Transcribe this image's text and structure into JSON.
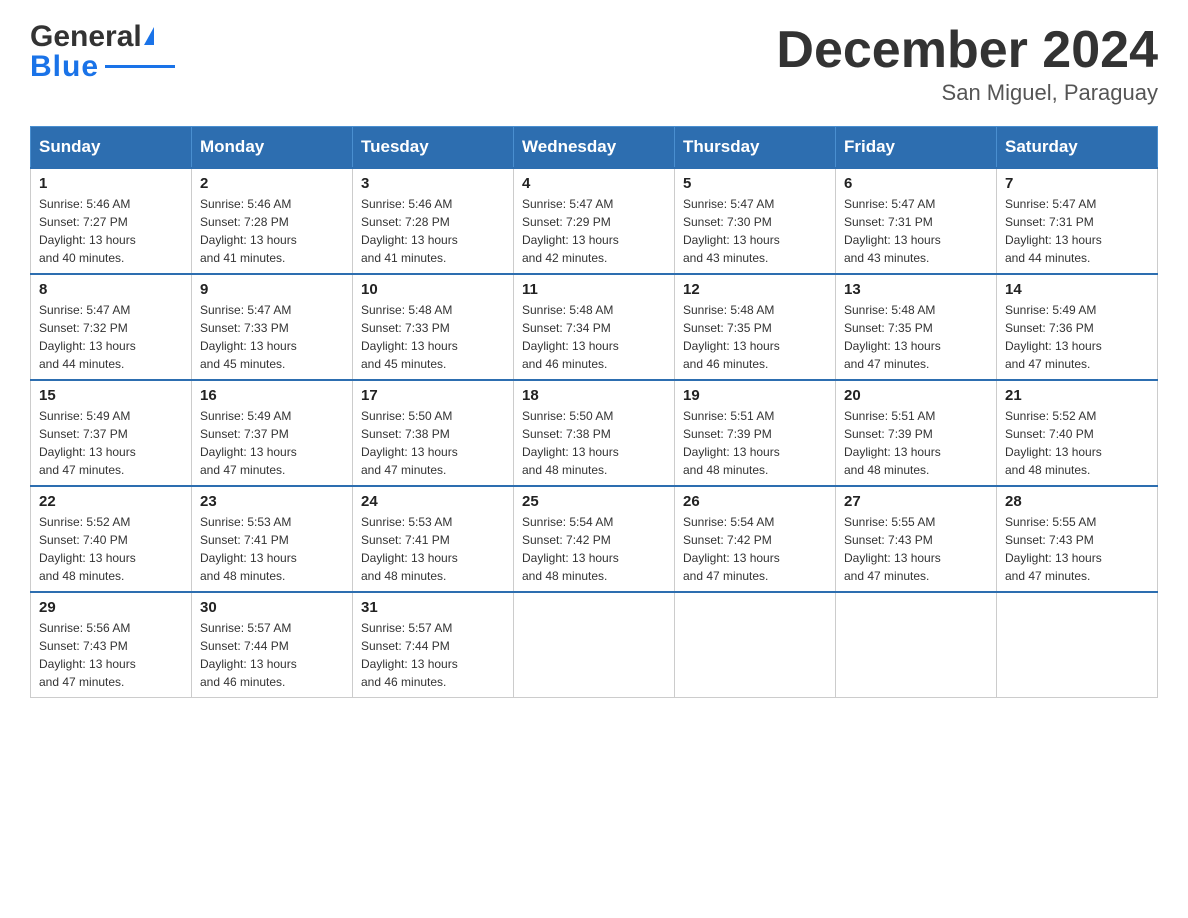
{
  "logo": {
    "text_general": "General",
    "text_blue": "Blue",
    "triangle": "▶"
  },
  "header": {
    "title": "December 2024",
    "subtitle": "San Miguel, Paraguay"
  },
  "weekdays": [
    "Sunday",
    "Monday",
    "Tuesday",
    "Wednesday",
    "Thursday",
    "Friday",
    "Saturday"
  ],
  "weeks": [
    [
      {
        "day": "1",
        "sunrise": "5:46 AM",
        "sunset": "7:27 PM",
        "daylight": "13 hours and 40 minutes."
      },
      {
        "day": "2",
        "sunrise": "5:46 AM",
        "sunset": "7:28 PM",
        "daylight": "13 hours and 41 minutes."
      },
      {
        "day": "3",
        "sunrise": "5:46 AM",
        "sunset": "7:28 PM",
        "daylight": "13 hours and 41 minutes."
      },
      {
        "day": "4",
        "sunrise": "5:47 AM",
        "sunset": "7:29 PM",
        "daylight": "13 hours and 42 minutes."
      },
      {
        "day": "5",
        "sunrise": "5:47 AM",
        "sunset": "7:30 PM",
        "daylight": "13 hours and 43 minutes."
      },
      {
        "day": "6",
        "sunrise": "5:47 AM",
        "sunset": "7:31 PM",
        "daylight": "13 hours and 43 minutes."
      },
      {
        "day": "7",
        "sunrise": "5:47 AM",
        "sunset": "7:31 PM",
        "daylight": "13 hours and 44 minutes."
      }
    ],
    [
      {
        "day": "8",
        "sunrise": "5:47 AM",
        "sunset": "7:32 PM",
        "daylight": "13 hours and 44 minutes."
      },
      {
        "day": "9",
        "sunrise": "5:47 AM",
        "sunset": "7:33 PM",
        "daylight": "13 hours and 45 minutes."
      },
      {
        "day": "10",
        "sunrise": "5:48 AM",
        "sunset": "7:33 PM",
        "daylight": "13 hours and 45 minutes."
      },
      {
        "day": "11",
        "sunrise": "5:48 AM",
        "sunset": "7:34 PM",
        "daylight": "13 hours and 46 minutes."
      },
      {
        "day": "12",
        "sunrise": "5:48 AM",
        "sunset": "7:35 PM",
        "daylight": "13 hours and 46 minutes."
      },
      {
        "day": "13",
        "sunrise": "5:48 AM",
        "sunset": "7:35 PM",
        "daylight": "13 hours and 47 minutes."
      },
      {
        "day": "14",
        "sunrise": "5:49 AM",
        "sunset": "7:36 PM",
        "daylight": "13 hours and 47 minutes."
      }
    ],
    [
      {
        "day": "15",
        "sunrise": "5:49 AM",
        "sunset": "7:37 PM",
        "daylight": "13 hours and 47 minutes."
      },
      {
        "day": "16",
        "sunrise": "5:49 AM",
        "sunset": "7:37 PM",
        "daylight": "13 hours and 47 minutes."
      },
      {
        "day": "17",
        "sunrise": "5:50 AM",
        "sunset": "7:38 PM",
        "daylight": "13 hours and 47 minutes."
      },
      {
        "day": "18",
        "sunrise": "5:50 AM",
        "sunset": "7:38 PM",
        "daylight": "13 hours and 48 minutes."
      },
      {
        "day": "19",
        "sunrise": "5:51 AM",
        "sunset": "7:39 PM",
        "daylight": "13 hours and 48 minutes."
      },
      {
        "day": "20",
        "sunrise": "5:51 AM",
        "sunset": "7:39 PM",
        "daylight": "13 hours and 48 minutes."
      },
      {
        "day": "21",
        "sunrise": "5:52 AM",
        "sunset": "7:40 PM",
        "daylight": "13 hours and 48 minutes."
      }
    ],
    [
      {
        "day": "22",
        "sunrise": "5:52 AM",
        "sunset": "7:40 PM",
        "daylight": "13 hours and 48 minutes."
      },
      {
        "day": "23",
        "sunrise": "5:53 AM",
        "sunset": "7:41 PM",
        "daylight": "13 hours and 48 minutes."
      },
      {
        "day": "24",
        "sunrise": "5:53 AM",
        "sunset": "7:41 PM",
        "daylight": "13 hours and 48 minutes."
      },
      {
        "day": "25",
        "sunrise": "5:54 AM",
        "sunset": "7:42 PM",
        "daylight": "13 hours and 48 minutes."
      },
      {
        "day": "26",
        "sunrise": "5:54 AM",
        "sunset": "7:42 PM",
        "daylight": "13 hours and 47 minutes."
      },
      {
        "day": "27",
        "sunrise": "5:55 AM",
        "sunset": "7:43 PM",
        "daylight": "13 hours and 47 minutes."
      },
      {
        "day": "28",
        "sunrise": "5:55 AM",
        "sunset": "7:43 PM",
        "daylight": "13 hours and 47 minutes."
      }
    ],
    [
      {
        "day": "29",
        "sunrise": "5:56 AM",
        "sunset": "7:43 PM",
        "daylight": "13 hours and 47 minutes."
      },
      {
        "day": "30",
        "sunrise": "5:57 AM",
        "sunset": "7:44 PM",
        "daylight": "13 hours and 46 minutes."
      },
      {
        "day": "31",
        "sunrise": "5:57 AM",
        "sunset": "7:44 PM",
        "daylight": "13 hours and 46 minutes."
      },
      null,
      null,
      null,
      null
    ]
  ],
  "labels": {
    "sunrise": "Sunrise:",
    "sunset": "Sunset:",
    "daylight": "Daylight:"
  }
}
